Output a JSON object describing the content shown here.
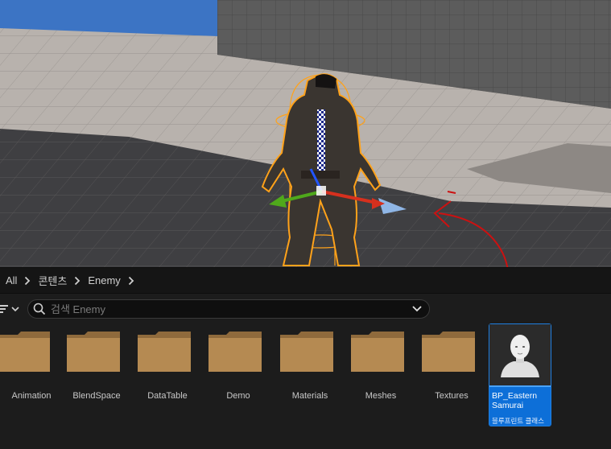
{
  "breadcrumb": [
    {
      "label": "All"
    },
    {
      "label": "콘텐츠"
    },
    {
      "label": "Enemy"
    }
  ],
  "search": {
    "placeholder": "검색 Enemy",
    "value": ""
  },
  "folders": [
    {
      "label": "Animation"
    },
    {
      "label": "BlendSpace"
    },
    {
      "label": "DataTable"
    },
    {
      "label": "Demo"
    },
    {
      "label": "Materials"
    },
    {
      "label": "Meshes"
    },
    {
      "label": "Textures"
    }
  ],
  "selected_asset": {
    "name": "BP_Eastern Samurai",
    "type_label": "블루프린트 클래스",
    "accent_color": "#0d6fd8"
  },
  "colors": {
    "folder": "#b58a52",
    "selection_outline": "#ffa21a",
    "gizmo_x": "#d6301e",
    "gizmo_y": "#4fa81b",
    "gizmo_z": "#2255ff",
    "annotation_arrow": "#cc1111"
  },
  "icons": [
    "filter-icon",
    "chevron-down-icon",
    "search-icon",
    "chevron-right-icon",
    "folder-icon",
    "character-thumbnail-icon"
  ]
}
